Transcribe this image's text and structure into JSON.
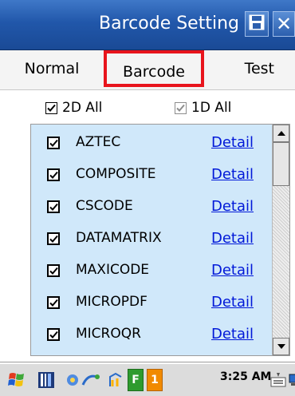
{
  "window": {
    "title": "Barcode Setting",
    "save_icon": "save-icon",
    "close_label": "✕"
  },
  "tabs": [
    {
      "label": "Normal",
      "selected": false
    },
    {
      "label": "Barcode",
      "selected": true
    },
    {
      "label": "Test",
      "selected": false
    }
  ],
  "groups": {
    "2d": {
      "label": "2D All",
      "checked": true
    },
    "1d": {
      "label": "1D All",
      "checked": true,
      "dimmed": true
    }
  },
  "barcodes": [
    {
      "name": "AZTEC",
      "checked": true,
      "detail": "Detail"
    },
    {
      "name": "COMPOSITE",
      "checked": true,
      "detail": "Detail"
    },
    {
      "name": "CSCODE",
      "checked": true,
      "detail": "Detail"
    },
    {
      "name": "DATAMATRIX",
      "checked": true,
      "detail": "Detail"
    },
    {
      "name": "MAXICODE",
      "checked": true,
      "detail": "Detail"
    },
    {
      "name": "MICROPDF",
      "checked": true,
      "detail": "Detail"
    },
    {
      "name": "MICROQR",
      "checked": true,
      "detail": "Detail"
    }
  ],
  "taskbar": {
    "time": "3:25 AM",
    "badge_f": "F",
    "badge_1": "1"
  },
  "colors": {
    "titlebar": "#2157aa",
    "list_bg": "#d0e8fa",
    "link": "#0018d8",
    "highlight": "#e8141c"
  }
}
